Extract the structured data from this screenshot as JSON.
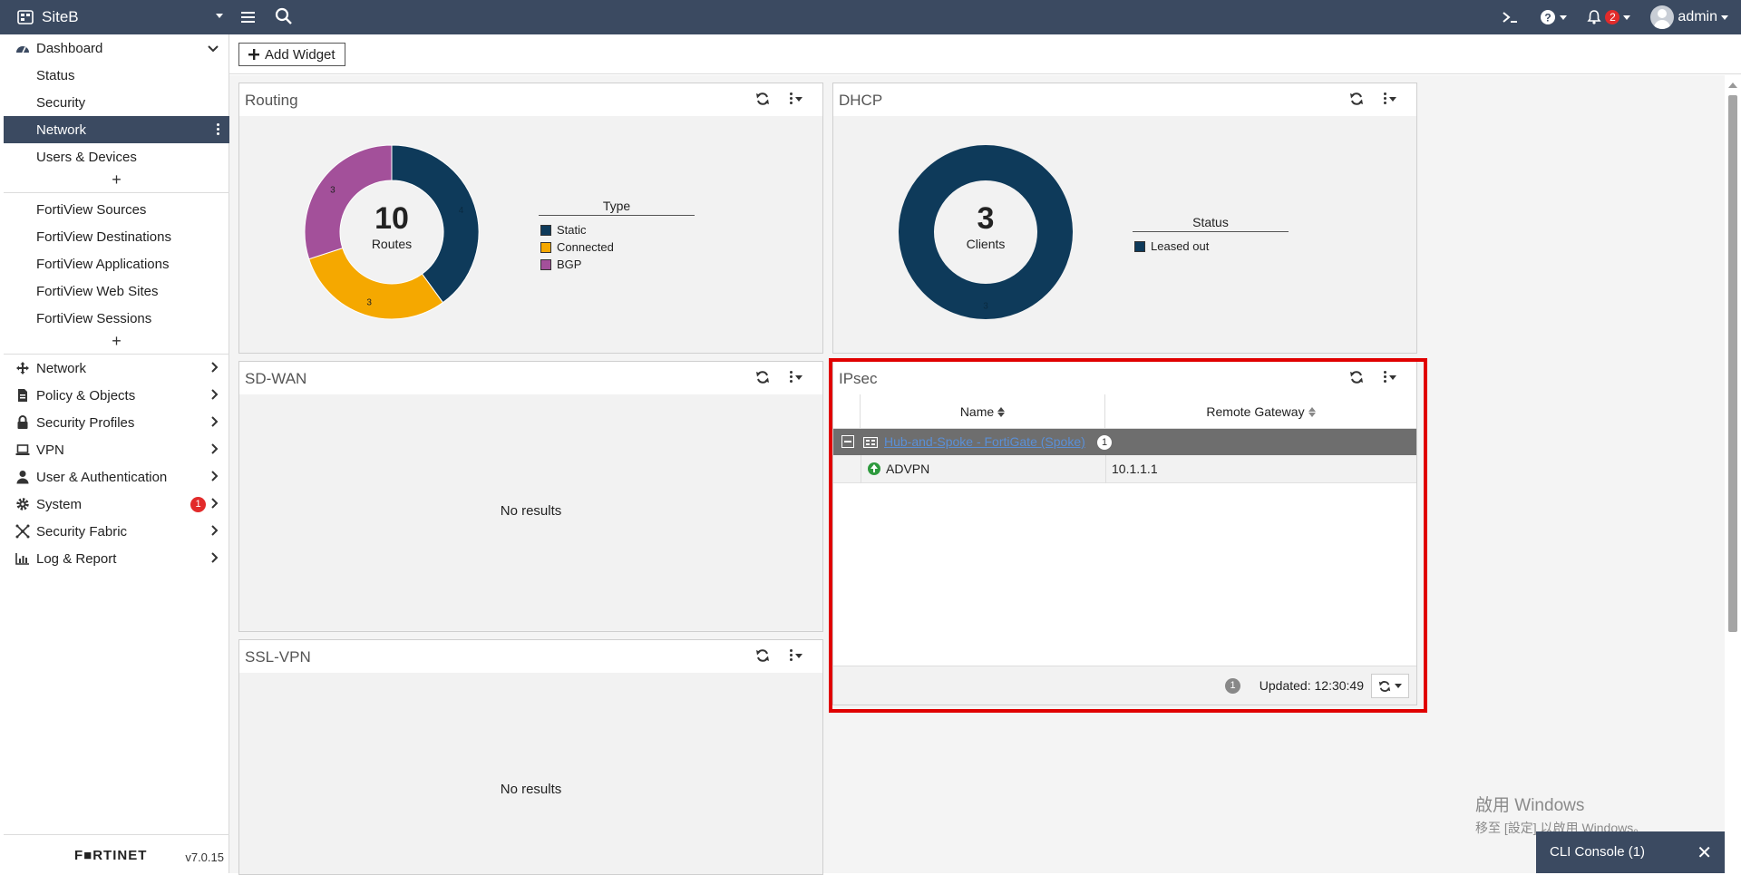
{
  "header": {
    "site_name": "SiteB",
    "user": "admin",
    "alerts_count": "2"
  },
  "sidebar": {
    "dashboard_label": "Dashboard",
    "dashboard_items": [
      "Status",
      "Security",
      "Network",
      "Users & Devices"
    ],
    "fortiview_items": [
      "FortiView Sources",
      "FortiView Destinations",
      "FortiView Applications",
      "FortiView Web Sites",
      "FortiView Sessions"
    ],
    "plus": "+",
    "menu": [
      {
        "label": "Network",
        "icon": "network-icon"
      },
      {
        "label": "Policy & Objects",
        "icon": "policy-icon"
      },
      {
        "label": "Security Profiles",
        "icon": "lock-icon"
      },
      {
        "label": "VPN",
        "icon": "laptop-icon"
      },
      {
        "label": "User & Authentication",
        "icon": "user-icon"
      },
      {
        "label": "System",
        "icon": "gear-icon",
        "badge": "1"
      },
      {
        "label": "Security Fabric",
        "icon": "fabric-icon"
      },
      {
        "label": "Log & Report",
        "icon": "chart-icon"
      }
    ],
    "logo": "F■RTINET",
    "version": "v7.0.15"
  },
  "toolbar": {
    "add_widget": "Add Widget"
  },
  "widgets": {
    "routing": {
      "title": "Routing",
      "center_value": "10",
      "center_label": "Routes",
      "legend_title": "Type",
      "legend": [
        {
          "label": "Static",
          "color": "#0e3a5a"
        },
        {
          "label": "Connected",
          "color": "#f5a800"
        },
        {
          "label": "BGP",
          "color": "#a3509a"
        }
      ],
      "slice_labels": [
        "4",
        "3",
        "3"
      ]
    },
    "dhcp": {
      "title": "DHCP",
      "center_value": "3",
      "center_label": "Clients",
      "legend_title": "Status",
      "legend": [
        {
          "label": "Leased out",
          "color": "#0e3a5a"
        }
      ],
      "slice_labels": [
        "3"
      ]
    },
    "sdwan": {
      "title": "SD-WAN",
      "empty": "No results"
    },
    "sslvpn": {
      "title": "SSL-VPN",
      "empty": "No results"
    },
    "ipsec": {
      "title": "IPsec",
      "columns": [
        "Name",
        "Remote Gateway"
      ],
      "group": {
        "name": "Hub-and-Spoke - FortiGate (Spoke)",
        "count": "1"
      },
      "rows": [
        {
          "name": "ADVPN",
          "gateway": "10.1.1.1",
          "status": "up"
        }
      ],
      "footer_count": "1",
      "updated": "Updated: 12:30:49"
    }
  },
  "watermark": {
    "line1": "啟用 Windows",
    "line2": "移至 [設定] 以啟用 Windows。"
  },
  "cli": {
    "label": "CLI Console (1)",
    "close": "✕"
  },
  "chart_data": [
    {
      "type": "pie",
      "title": "Routing",
      "categories": [
        "Static",
        "Connected",
        "BGP"
      ],
      "values": [
        4,
        3,
        3
      ],
      "colors": [
        "#0e3a5a",
        "#f5a800",
        "#a3509a"
      ],
      "legend": "right"
    },
    {
      "type": "pie",
      "title": "DHCP",
      "categories": [
        "Leased out"
      ],
      "values": [
        3
      ],
      "colors": [
        "#0e3a5a"
      ],
      "legend": "right"
    }
  ]
}
